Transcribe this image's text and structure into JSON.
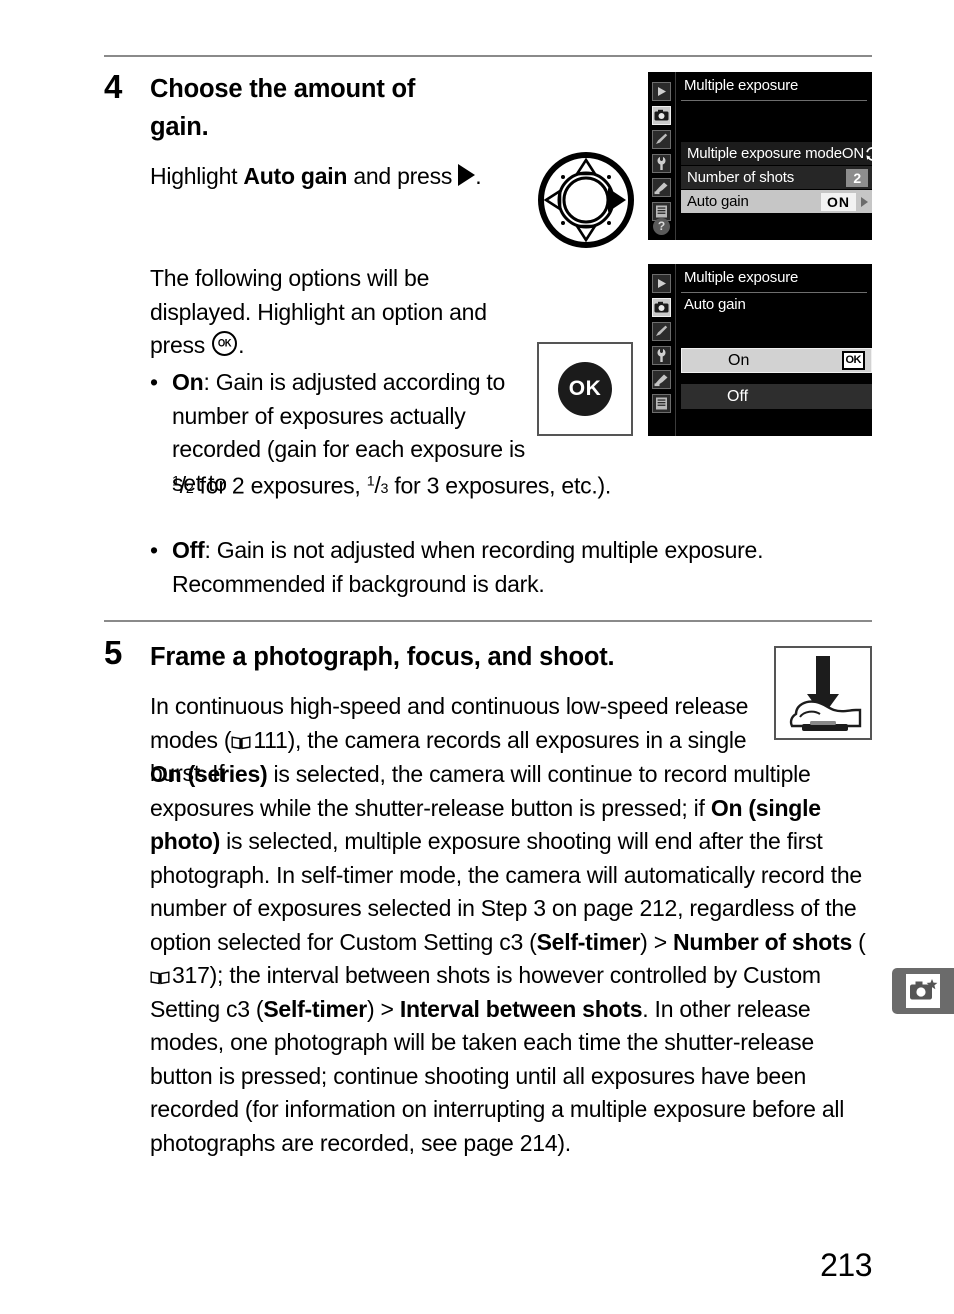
{
  "page": {
    "number": "213"
  },
  "steps": [
    {
      "number": "4",
      "heading": "Choose the amount of gain.",
      "para1_before": "Highlight ",
      "para1_bold": "Auto gain",
      "para1_after": " and press ",
      "para1_end": ".",
      "para2_a": "The following options will be displayed.  Highlight an option and press ",
      "para2_b": ".",
      "bullets": [
        {
          "marker": "•",
          "bold": "On",
          "text_a": ": Gain is adjusted according to number of exposures actually recorded (gain for each exposure is set to ",
          "frac1_num": "1",
          "frac1_den": "2",
          "text_b": " for 2 exposures, ",
          "frac2_num": "1",
          "frac2_den": "3",
          "text_c": " for 3 exposures, etc.)."
        },
        {
          "marker": "•",
          "bold": "Off",
          "text_a": ": Gain is not adjusted when recording multiple exposure. Recommended if background is dark."
        }
      ]
    },
    {
      "number": "5",
      "heading": "Frame a photograph, focus, and shoot.",
      "body": {
        "seg1": "In continuous high-speed and continuous low-speed release modes (",
        "ref1": "111",
        "seg2": "), the camera records all exposures in a single burst.  If ",
        "bold1": "On (series)",
        "seg3": " is selected, the camera will continue to record multiple exposures while the shutter-release button is pressed; if ",
        "bold2": "On (single photo)",
        "seg4": " is selected, multiple exposure shooting will end after the first photograph.  In self-timer mode, the camera will automatically record the number of exposures selected in Step 3 on page 212, regardless of the option selected for Custom Setting c3 (",
        "bold3": "Self-timer",
        "seg5": ") > ",
        "bold4": "Number of shots",
        "seg6": " (",
        "ref2": "317",
        "seg7": "); the interval between shots is however controlled by Custom Setting c3 (",
        "bold5": "Self-timer",
        "seg8": ") > ",
        "bold6": "Interval between shots",
        "seg9": ".  In other release modes, one photograph will be taken each time the shutter-release button is pressed; continue shooting until all exposures have been recorded (for information on interrupting a multiple exposure before all photographs are recorded, see page 214)."
      }
    }
  ],
  "lcd_screen_1": {
    "title": "Multiple exposure",
    "sidebar_icons": [
      "playback-icon",
      "shooting-menu-icon",
      "custom-setting-pencil-icon",
      "setup-wrench-icon",
      "retouch-brush-icon",
      "recent-settings-icon"
    ],
    "help_label": "?",
    "rows": [
      {
        "label": "Multiple exposure mode",
        "value": "ON",
        "value_icon": "cycle-icon",
        "state": "normal"
      },
      {
        "label": "Number of shots",
        "value": "2",
        "value_icon": "",
        "state": "normal"
      },
      {
        "label": "Auto gain",
        "value": "ON",
        "value_icon": "chevron-right-icon",
        "state": "selected"
      }
    ]
  },
  "lcd_screen_2": {
    "title": "Multiple exposure",
    "subtitle": "Auto gain",
    "sidebar_icons": [
      "playback-icon",
      "shooting-menu-icon",
      "custom-setting-pencil-icon",
      "setup-wrench-icon",
      "retouch-brush-icon",
      "recent-settings-icon"
    ],
    "options": [
      {
        "label": "On",
        "badge": "OK",
        "state": "selected"
      },
      {
        "label": "Off",
        "badge": "",
        "state": "normal"
      }
    ]
  },
  "illustrations": {
    "multi_selector": {
      "name": "multi-selector-diagram",
      "highlighted_direction": "right"
    },
    "ok_button": {
      "name": "ok-button-diagram",
      "label": "OK"
    },
    "shutter_press": {
      "name": "shutter-release-press-diagram"
    }
  },
  "thumb_tab": {
    "icon": "camera-star-icon"
  }
}
